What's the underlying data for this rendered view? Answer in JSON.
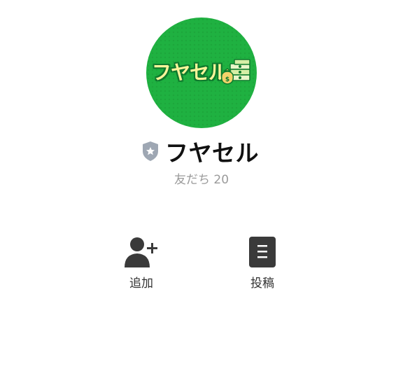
{
  "profile": {
    "avatar_icon": "fuyaseru-logo",
    "logo_text": "フヤセル",
    "name": "フヤセル",
    "badge_icon": "shield-star-icon",
    "friends_label": "友だち",
    "friends_count": "20"
  },
  "actions": {
    "add": {
      "label": "追加",
      "icon": "add-friend-icon"
    },
    "post": {
      "label": "投稿",
      "icon": "posts-icon"
    }
  },
  "colors": {
    "avatar_bg": "#1fb141",
    "logo_text": "#fbf49a",
    "badge": "#9ea7b3",
    "icon": "#3a3a3a"
  }
}
